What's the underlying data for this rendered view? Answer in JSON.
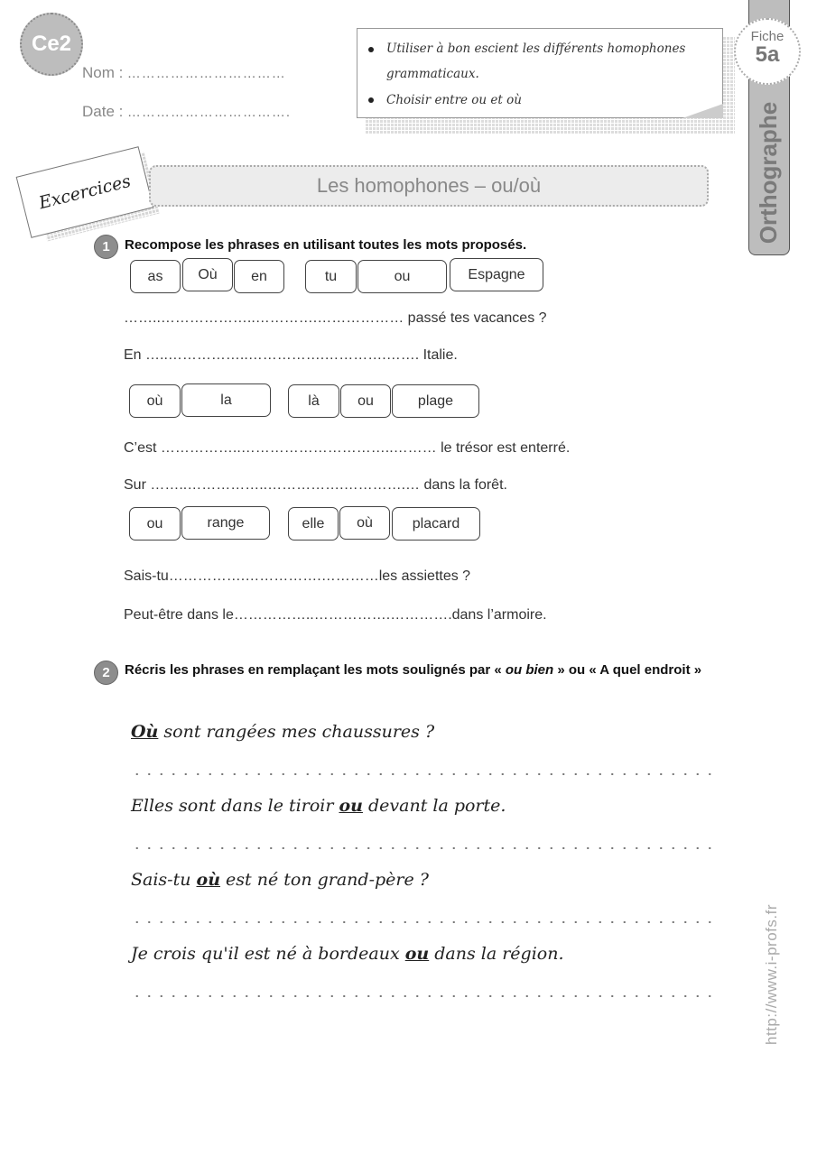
{
  "header": {
    "level_badge": "Ce2",
    "name_label": "Nom :",
    "name_dots": "……………………………",
    "date_label": "Date :",
    "date_dots": "……………………………."
  },
  "objectives": [
    "Utiliser à bon escient les différents homophones grammaticaux.",
    "Choisir entre ou et où"
  ],
  "side_tab": {
    "fiche_label": "Fiche",
    "fiche_number": "5a",
    "subject": "Orthographe"
  },
  "section_label": "Excercices",
  "title": "Les homophones – ou/où",
  "exercise1": {
    "number": "1",
    "instruction": "Recompose les phrases en utilisant toutes les mots proposés.",
    "groups": [
      {
        "tiles_a": [
          "as",
          "Où",
          "en"
        ],
        "tiles_b": [
          "tu",
          "ou",
          "Espagne"
        ],
        "sentences": [
          "……..………………..………….……………… passé tes vacances ?",
          "En …..……………..…………….………….……. Italie."
        ]
      },
      {
        "tiles_a": [
          "où",
          "la"
        ],
        "tiles_b": [
          "là",
          "ou",
          "plage"
        ],
        "sentences": [
          "C’est ……………..…………………………..……… le trésor est enterré.",
          "Sur ……..……………..…………….………….… dans la forêt."
        ]
      },
      {
        "tiles_a": [
          "ou",
          "range"
        ],
        "tiles_b": [
          "elle",
          "où",
          "placard"
        ],
        "sentences": [
          "Sais-tu…………….…………….…………les assiettes ?",
          "Peut-être dans le……………..…………….………….dans l’armoire."
        ]
      }
    ]
  },
  "exercise2": {
    "number": "2",
    "instruction_parts": {
      "before": "Récris les phrases en remplaçant les mots soulignés par « ",
      "italic": "ou bien",
      "after": " » ou «  A quel endroit »"
    },
    "sentences": [
      {
        "before": "",
        "underlined": "Où",
        "after": " sont rangées mes chaussures ?"
      },
      {
        "before": "Elles sont dans le tiroir ",
        "underlined": "ou",
        "after": " devant la porte."
      },
      {
        "before": "Sais-tu ",
        "underlined": "où",
        "after": " est né ton grand-père ?"
      },
      {
        "before": "Je crois qu'il est né à bordeaux ",
        "underlined": "ou",
        "after": " dans la région."
      }
    ]
  },
  "footer": {
    "site_url": "http://www.i-profs.fr"
  }
}
